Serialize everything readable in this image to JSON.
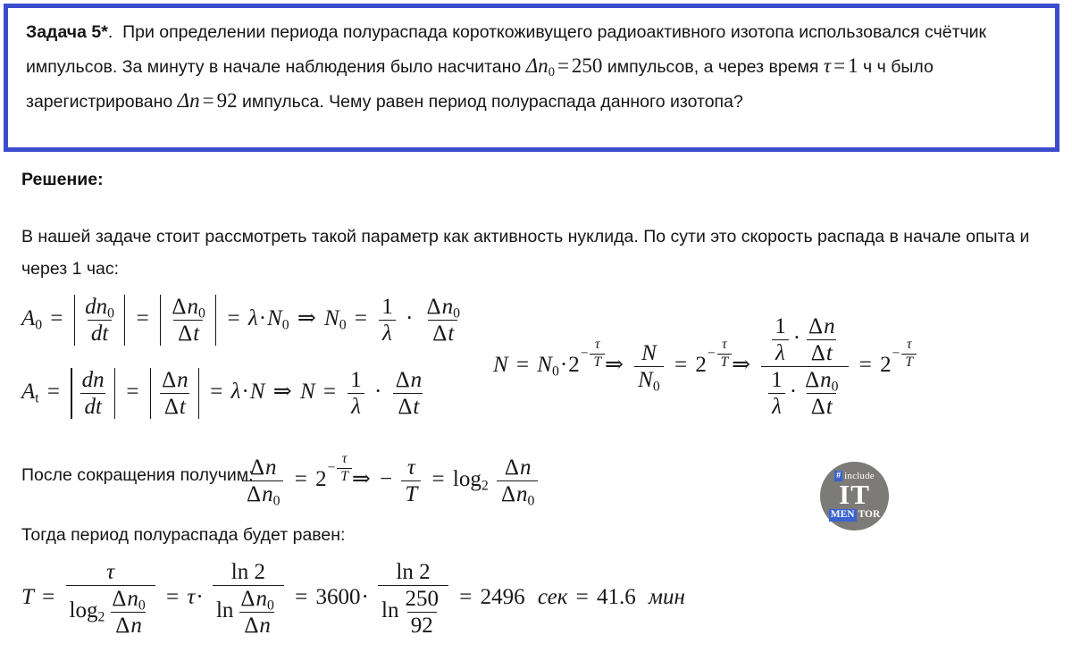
{
  "document": {
    "title": "Задача 5* — период полураспада короткоживущего радиоактивного изотопа",
    "border_color": "#3b4ccc",
    "background_color": "#ffffff",
    "text_color": "#151515"
  },
  "problem": {
    "label": "Задача 5*",
    "label_suffix": ".",
    "text_part_1": "При определении периода полураспада короткоживущего радиоактивного изотопа использовался счётчик импульсов. За минуту в начале наблюдения было насчитано",
    "math_dn0": "Δn₀ = 250",
    "text_part_2": "импульсов, а через время",
    "math_tau": "τ = 1",
    "text_part_3": "ч было зарегистрировано",
    "math_dn": "Δn = 92",
    "text_part_4": "импульса. Чему равен период полураспада данного изотопа?",
    "given": {
      "delta_n0_symbol": "Δn",
      "delta_n0_sub": "0",
      "delta_n0_value": "250",
      "tau_symbol": "τ",
      "tau_value": "1",
      "tau_unit": "ч",
      "delta_n_symbol": "Δn",
      "delta_n_value": "92",
      "equals": "="
    }
  },
  "solution": {
    "heading": "Решение:",
    "intro": "В нашей задаче стоит рассмотреть такой параметр как активность нуклида. По сути это скорость распада в начале опыта и через 1 час:",
    "after_reduction_label": "После сокращения получим:",
    "then_halflife_label": "Тогда период полураспада будет равен:"
  },
  "math": {
    "symbols": {
      "A": "A",
      "A_sub_0": "0",
      "A_sub_t": "t",
      "d": "d",
      "n": "n",
      "n_sub_0": "0",
      "t": "t",
      "delta": "Δ",
      "lambda": "λ",
      "N": "N",
      "N_sub_0": "0",
      "T": "T",
      "tau": "τ",
      "two": "2",
      "one": "1",
      "equals": "=",
      "dot": "·",
      "implies": "⇒",
      "minus": "−",
      "log": "log",
      "log_base": "2",
      "ln": "ln"
    },
    "formula_a0": "A₀ = |dn₀/dt| = |Δn₀/Δt| = λ·N₀ ⇒ N₀ = (1/λ)·(Δn₀/Δt)",
    "formula_at": "Aₜ = |dn/dt| = |Δn/Δt| = λ·N ⇒ N = (1/λ)·(Δn/Δt)",
    "formula_decay": "N = N₀·2^(−τ/T) ⇒ N/N₀ = 2^(−τ/T) ⇒ [(1/λ)·(Δn/Δt)] / [(1/λ)·(Δn₀/Δt)] = 2^(−τ/T)",
    "formula_reduced": "Δn/Δn₀ = 2^(−τ/T) ⇒ −τ/T = log₂(Δn/Δn₀)",
    "formula_final": "T = τ / log₂(Δn₀/Δn) = τ · ln2 / ln(Δn₀/Δn) = 3600 · ln2 / ln(250/92) = 2496 сек = 41.6 мин",
    "values": {
      "tau_seconds": "3600",
      "ratio_numerator": "250",
      "ratio_denominator": "92",
      "result_seconds": "2496",
      "result_seconds_unit": "сек",
      "result_minutes": "41.6",
      "result_minutes_unit": "мин",
      "ln_expression": "ln 2"
    }
  },
  "logo": {
    "hash": "#",
    "include": "include",
    "it": "IT",
    "men": "MEN",
    "tor": "TOR",
    "circle_color": "#7c7b78",
    "accent_color": "#3a63d0"
  }
}
